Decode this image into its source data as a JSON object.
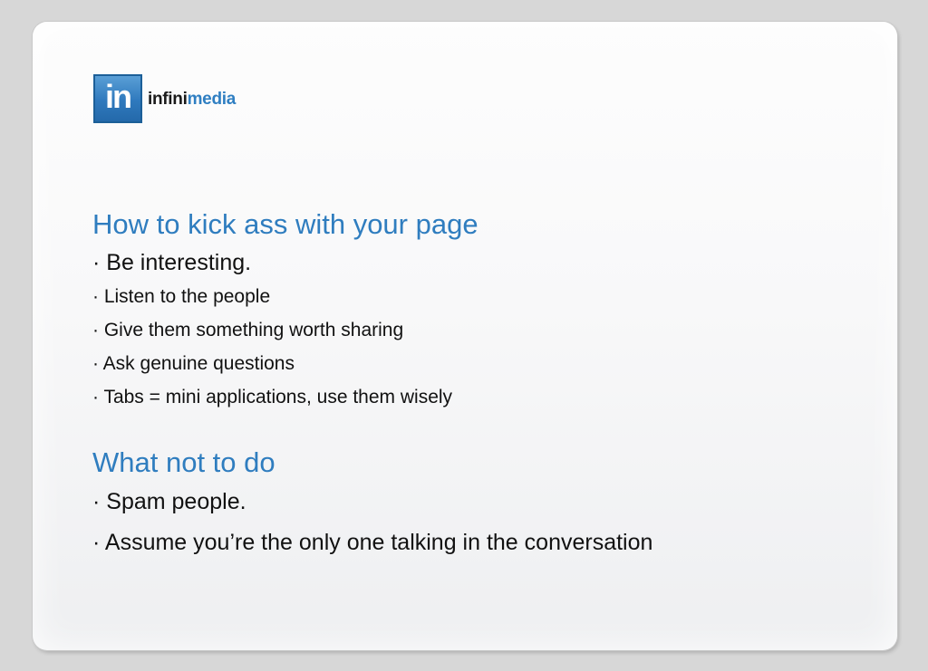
{
  "logo": {
    "mark": "in",
    "text_part1": "infini",
    "text_part2": "media",
    "accent_color": "#2f7fc2"
  },
  "sections": [
    {
      "heading": "How to kick ass with your page",
      "bullets": [
        "· Be interesting.",
        "· Listen to the people",
        "· Give them something worth sharing",
        "· Ask genuine questions",
        "· Tabs = mini applications, use them wisely"
      ]
    },
    {
      "heading": "What not to do",
      "bullets": [
        "· Spam people.",
        "· Assume you’re the only one talking in the conversation"
      ]
    }
  ],
  "colors": {
    "heading": "#2f7dbf",
    "text": "#111111",
    "background": "#d7d7d7"
  }
}
